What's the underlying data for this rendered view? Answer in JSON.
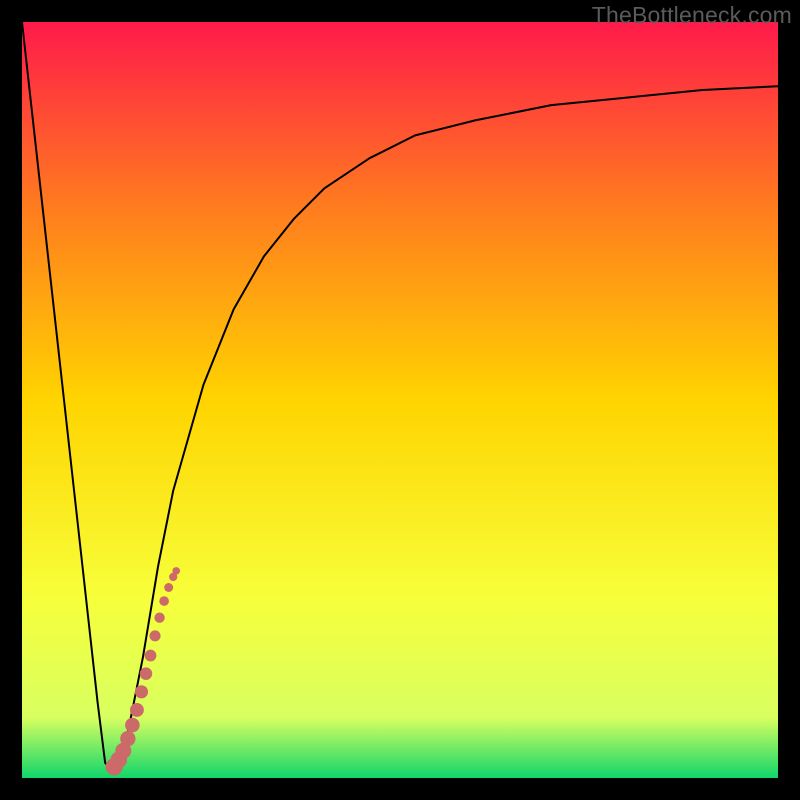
{
  "watermark": "TheBottleneck.com",
  "chart_data": {
    "type": "line",
    "title": "",
    "xlabel": "",
    "ylabel": "",
    "xlim": [
      0,
      100
    ],
    "ylim": [
      0,
      100
    ],
    "optimal_x": 11,
    "gradient_colors": {
      "top": "#ff1a4a",
      "mid_upper": "#ff7a1f",
      "mid": "#ffd400",
      "mid_lower": "#f7ff3a",
      "lower": "#d8ff60",
      "bottom": "#10d66a"
    },
    "series": [
      {
        "name": "bottleneck-curve",
        "color": "#000000",
        "stroke_width": 2,
        "x": [
          0,
          2,
          4,
          6,
          8,
          10,
          11,
          12,
          13,
          14,
          16,
          18,
          20,
          24,
          28,
          32,
          36,
          40,
          46,
          52,
          60,
          70,
          80,
          90,
          100
        ],
        "y": [
          100,
          82,
          64,
          46,
          28,
          10,
          2,
          1,
          2,
          6,
          16,
          28,
          38,
          52,
          62,
          69,
          74,
          78,
          82,
          85,
          87,
          89,
          90,
          91,
          91.5
        ]
      },
      {
        "name": "highlight-dots",
        "color": "#cc6a6a",
        "x": [
          12.2,
          12.8,
          13.4,
          14.0,
          14.6,
          15.2,
          15.8,
          16.4,
          17.0,
          17.6,
          18.2,
          18.8,
          19.4,
          20.0,
          20.4
        ],
        "y": [
          1.5,
          2.4,
          3.6,
          5.2,
          7.0,
          9.0,
          11.4,
          13.8,
          16.2,
          18.8,
          21.2,
          23.4,
          25.2,
          26.6,
          27.4
        ]
      }
    ]
  }
}
